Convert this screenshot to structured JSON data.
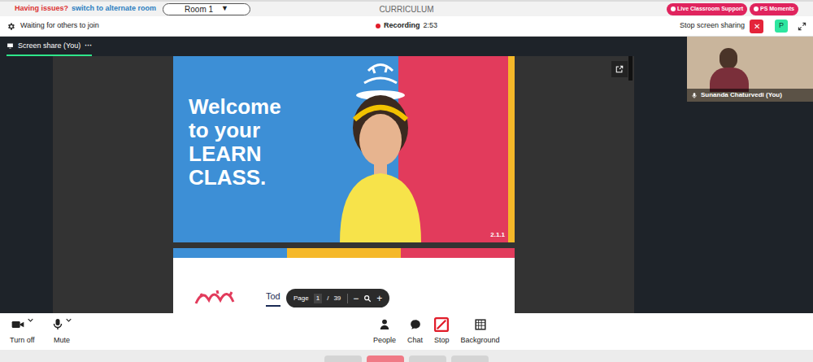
{
  "top_bar": {
    "issue_text": "Having issues?",
    "alt_room_link": "switch to alternate room",
    "room_select": "Room 1",
    "room_arrow": "▼",
    "title": "CURRICULUM",
    "buttons": [
      {
        "label": "Live Classroom Support"
      },
      {
        "label": "PS Moments"
      }
    ]
  },
  "status_bar": {
    "waiting": "Waiting for others to join",
    "recording_label": "Recording",
    "recording_time": "2:53",
    "stop_share": "Stop screen sharing",
    "stop_share_close": "✕",
    "avatar": "P"
  },
  "share_tab": {
    "label": "Screen share (You)",
    "menu": "···",
    "selected": true
  },
  "slides": {
    "title_lines": [
      "Welcome",
      "to your",
      "LEARN",
      "CLASS."
    ],
    "code": "2.1.1",
    "next_heading": "Tod"
  },
  "page_toolbar": {
    "label": "Page",
    "page": "1",
    "separator": "/",
    "total": "39",
    "zoom_out": "−",
    "zoom_in": "+"
  },
  "self_video": {
    "name": "Sunanda Chaturvedi (You)"
  },
  "left_controls": [
    {
      "label": "Turn off",
      "kind": "camera"
    },
    {
      "label": "Mute",
      "kind": "mic"
    }
  ],
  "center_controls": [
    {
      "label": "People",
      "kind": "people"
    },
    {
      "label": "Chat",
      "kind": "chat"
    },
    {
      "label": "Stop",
      "kind": "stop"
    },
    {
      "label": "Background",
      "kind": "background"
    }
  ]
}
